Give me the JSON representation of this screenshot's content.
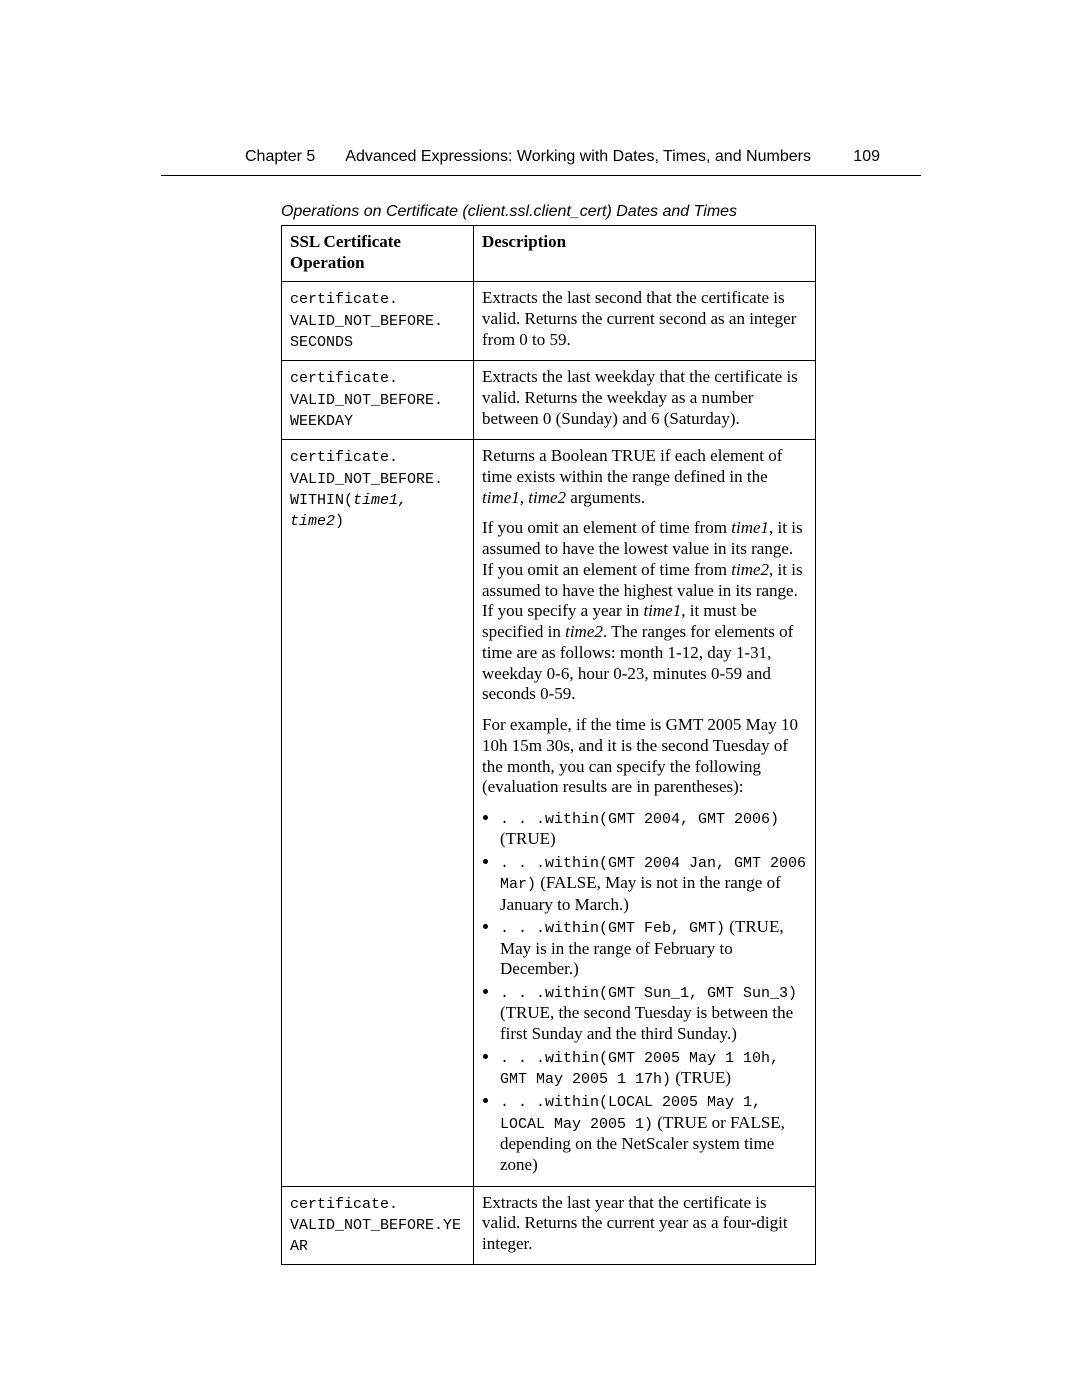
{
  "header": {
    "chapter": "Chapter 5",
    "title": "Advanced Expressions: Working with Dates, Times, and Numbers",
    "page": "109"
  },
  "caption": "Operations on Certificate (client.ssl.client_cert) Dates and Times",
  "table": {
    "head": {
      "op": "SSL Certificate Operation",
      "desc": "Description"
    },
    "rows": {
      "r1": {
        "op_l1": "certificate.",
        "op_l2": "VALID_NOT_BEFORE.",
        "op_l3": "SECONDS",
        "desc": "Extracts the last second that the certificate is valid. Returns the current second as an integer from 0 to 59."
      },
      "r2": {
        "op_l1": "certificate.",
        "op_l2": "VALID_NOT_BEFORE.",
        "op_l3": "WEEKDAY",
        "desc": "Extracts the last weekday that the certificate is valid. Returns the weekday as a number between 0 (Sunday) and 6 (Saturday)."
      },
      "r3": {
        "op_l1": "certificate.",
        "op_l2": "VALID_NOT_BEFORE.",
        "op_l3a": "WITHIN(",
        "op_l3b": "time1, time2",
        "op_l3c": ")",
        "p1a": "Returns a Boolean TRUE if each element of time exists within the range defined in the ",
        "p1b": "time1, time2",
        "p1c": " arguments.",
        "p2a": "If you omit an element of time from ",
        "p2b": "time1",
        "p2c": ", it is assumed to have the lowest value in its range. If you omit an element of time from ",
        "p2d": "time2",
        "p2e": ", it is assumed to have the highest value in its range. If you specify a year in ",
        "p2f": "time1",
        "p2g": ", it must be specified in ",
        "p2h": "time2",
        "p2i": ". The ranges for elements of time are as follows: month 1-12, day 1-31, weekday 0-6, hour 0-23, minutes 0-59 and seconds 0-59.",
        "p3": "For example, if the time is GMT 2005 May 10 10h 15m 30s, and it is the second Tuesday of the month, you can specify the following (evaluation results are in parentheses):",
        "b1_code": ". . .within(GMT 2004, GMT 2006)",
        "b1_res": "(TRUE)",
        "b2_code": ". . .within(GMT 2004 Jan, GMT 2006 Mar)",
        "b2_res": " (FALSE, May is not in the range of January to March.)",
        "b3_code": ". . .within(GMT Feb, GMT)",
        "b3_res": " (TRUE, May is in the range of February to December.)",
        "b4_code": ". . .within(GMT Sun_1, GMT Sun_3)",
        "b4_res": " (TRUE, the second Tuesday is between the first Sunday and the third Sunday.)",
        "b5_code": ". . .within(GMT 2005 May 1 10h, GMT May 2005 1 17h)",
        "b5_res": " (TRUE)",
        "b6_code": ". . .within(LOCAL 2005 May 1, LOCAL May 2005 1)",
        "b6_res": " (TRUE or FALSE, depending on the NetScaler system time zone)"
      },
      "r4": {
        "op_l1": "certificate.",
        "op_l2": "VALID_NOT_BEFORE.YEAR",
        "desc": "Extracts the last year that the certificate is valid. Returns the current year as a four-digit integer."
      }
    }
  }
}
